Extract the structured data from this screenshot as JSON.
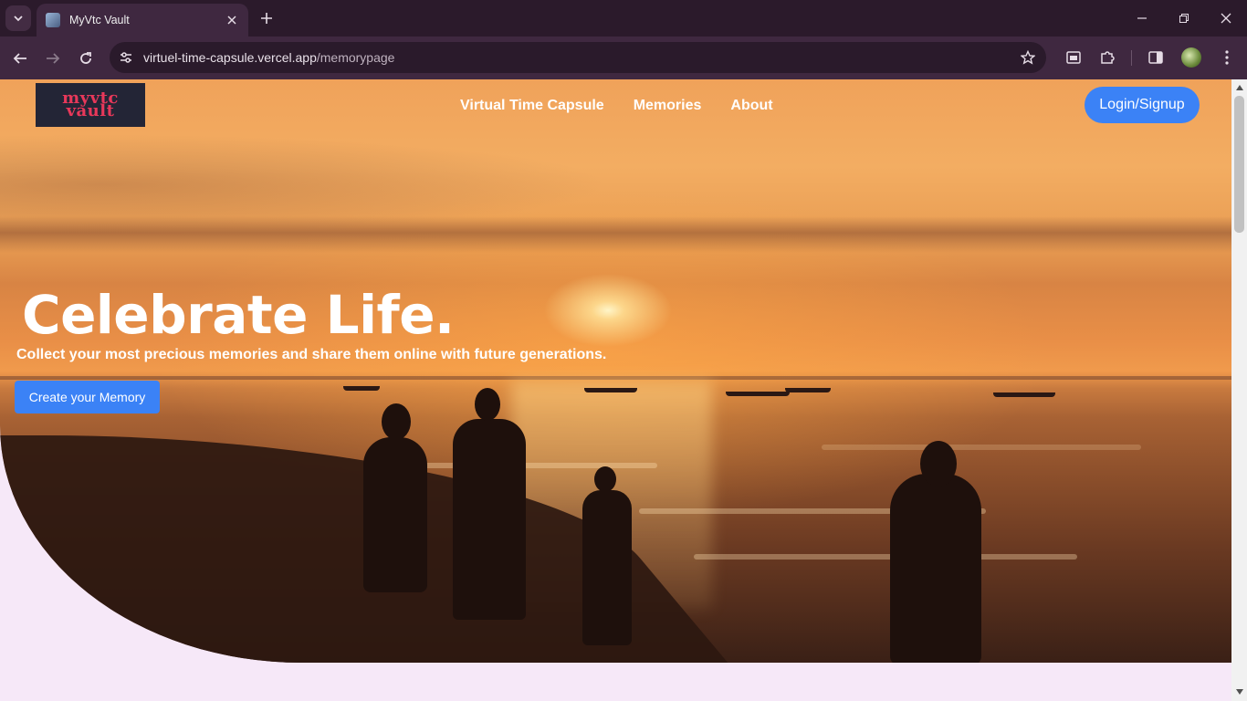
{
  "browser": {
    "tab_title": "MyVtc Vault",
    "url_host": "virtuel-time-capsule.vercel.app",
    "url_path": "/memorypage"
  },
  "site": {
    "logo_line1": "myvtc",
    "logo_line2": "vault",
    "nav": [
      "Virtual Time Capsule",
      "Memories",
      "About"
    ],
    "login_label": "Login/Signup",
    "hero_title": "Celebrate Life.",
    "hero_subtitle": "Collect your most precious memories and share them online with future generations.",
    "cta_label": "Create your Memory"
  },
  "colors": {
    "accent": "#3b82f6",
    "logo_text": "#e8385a",
    "logo_bg": "#232536",
    "page_bg": "#f6e8f8",
    "chrome_dark": "#2b1a2b",
    "chrome_toolbar": "#3f2840"
  },
  "icons": {
    "tab_search": "chevron-down-icon",
    "new_tab": "plus-icon",
    "back": "arrow-left-icon",
    "forward": "arrow-right-icon",
    "reload": "reload-icon",
    "site_info": "tune-icon",
    "bookmark": "star-icon",
    "extensions": "puzzle-icon"
  }
}
